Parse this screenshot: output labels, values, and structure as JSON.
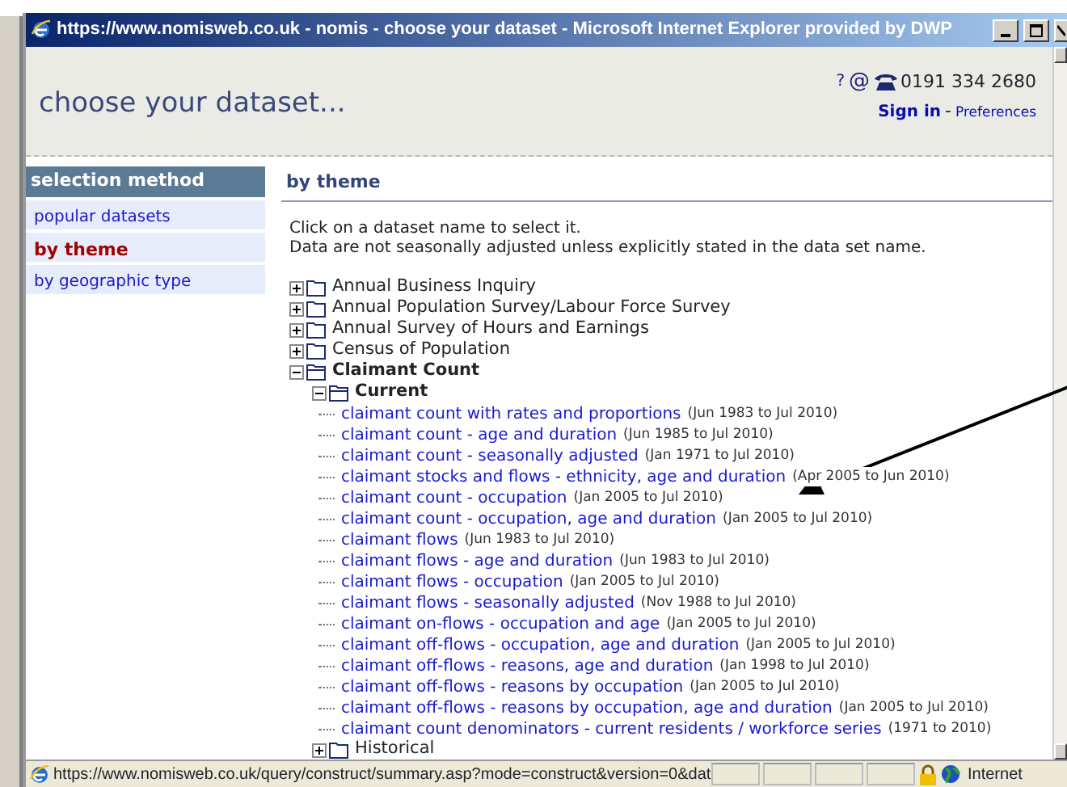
{
  "window": {
    "title": "https://www.nomisweb.co.uk - nomis - choose your dataset - Microsoft Internet Explorer provided by DWP"
  },
  "header": {
    "title": "choose your dataset...",
    "help": "?",
    "email": "@",
    "phone": "0191 334 2680",
    "sign_in": "Sign in",
    "separator": "-",
    "preferences": "Preferences"
  },
  "sidebar": {
    "title": "selection method",
    "items": [
      {
        "label": "popular datasets",
        "selected": false
      },
      {
        "label": "by theme",
        "selected": true
      },
      {
        "label": "by geographic type",
        "selected": false
      }
    ]
  },
  "main": {
    "title": "by theme",
    "intro": [
      "Click on a dataset name to select it.",
      "Data are not seasonally adjusted unless explicitly stated in the data set name."
    ],
    "tree": [
      {
        "kind": "folder",
        "label": "Annual Business Inquiry",
        "expanded": false
      },
      {
        "kind": "folder",
        "label": "Annual Population Survey/Labour Force Survey",
        "expanded": false
      },
      {
        "kind": "folder",
        "label": "Annual Survey of Hours and Earnings",
        "expanded": false
      },
      {
        "kind": "folder",
        "label": "Census of Population",
        "expanded": false
      },
      {
        "kind": "folder",
        "label": "Claimant Count",
        "expanded": true,
        "children": [
          {
            "kind": "folder",
            "label": "Current",
            "expanded": true,
            "children": [
              {
                "kind": "dataset",
                "label": "claimant count with rates and proportions",
                "range": "(Jun 1983 to Jul 2010)"
              },
              {
                "kind": "dataset",
                "label": "claimant count - age and duration",
                "range": "(Jun 1985 to Jul 2010)"
              },
              {
                "kind": "dataset",
                "label": "claimant count - seasonally adjusted",
                "range": "(Jan 1971 to Jul 2010)"
              },
              {
                "kind": "dataset",
                "label": "claimant stocks and flows - ethnicity, age and duration",
                "range": "(Apr 2005 to Jun 2010)"
              },
              {
                "kind": "dataset",
                "label": "claimant count - occupation",
                "range": "(Jan 2005 to Jul 2010)"
              },
              {
                "kind": "dataset",
                "label": "claimant count - occupation, age and duration",
                "range": "(Jan 2005 to Jul 2010)"
              },
              {
                "kind": "dataset",
                "label": "claimant flows",
                "range": "(Jun 1983 to Jul 2010)"
              },
              {
                "kind": "dataset",
                "label": "claimant flows - age and duration",
                "range": "(Jun 1983 to Jul 2010)"
              },
              {
                "kind": "dataset",
                "label": "claimant flows - occupation",
                "range": "(Jan 2005 to Jul 2010)"
              },
              {
                "kind": "dataset",
                "label": "claimant flows - seasonally adjusted",
                "range": "(Nov 1988 to Jul 2010)"
              },
              {
                "kind": "dataset",
                "label": "claimant on-flows - occupation and age",
                "range": "(Jan 2005 to Jul 2010)"
              },
              {
                "kind": "dataset",
                "label": "claimant off-flows - occupation, age and duration",
                "range": "(Jan 2005 to Jul 2010)"
              },
              {
                "kind": "dataset",
                "label": "claimant off-flows - reasons, age and duration",
                "range": "(Jan 1998 to Jul 2010)"
              },
              {
                "kind": "dataset",
                "label": "claimant off-flows - reasons by occupation",
                "range": "(Jan 2005 to Jul 2010)"
              },
              {
                "kind": "dataset",
                "label": "claimant off-flows - reasons by occupation, age and duration",
                "range": "(Jan 2005 to Jul 2010)"
              },
              {
                "kind": "dataset",
                "label": "claimant count denominators - current residents / workforce series",
                "range": "(1971 to 2010)"
              }
            ]
          },
          {
            "kind": "folder",
            "label": "Historical",
            "expanded": false
          }
        ]
      }
    ]
  },
  "status_bar": {
    "url": "https://www.nomisweb.co.uk/query/construct/summary.asp?mode=construct&version=0&dat",
    "zone": "Internet"
  }
}
